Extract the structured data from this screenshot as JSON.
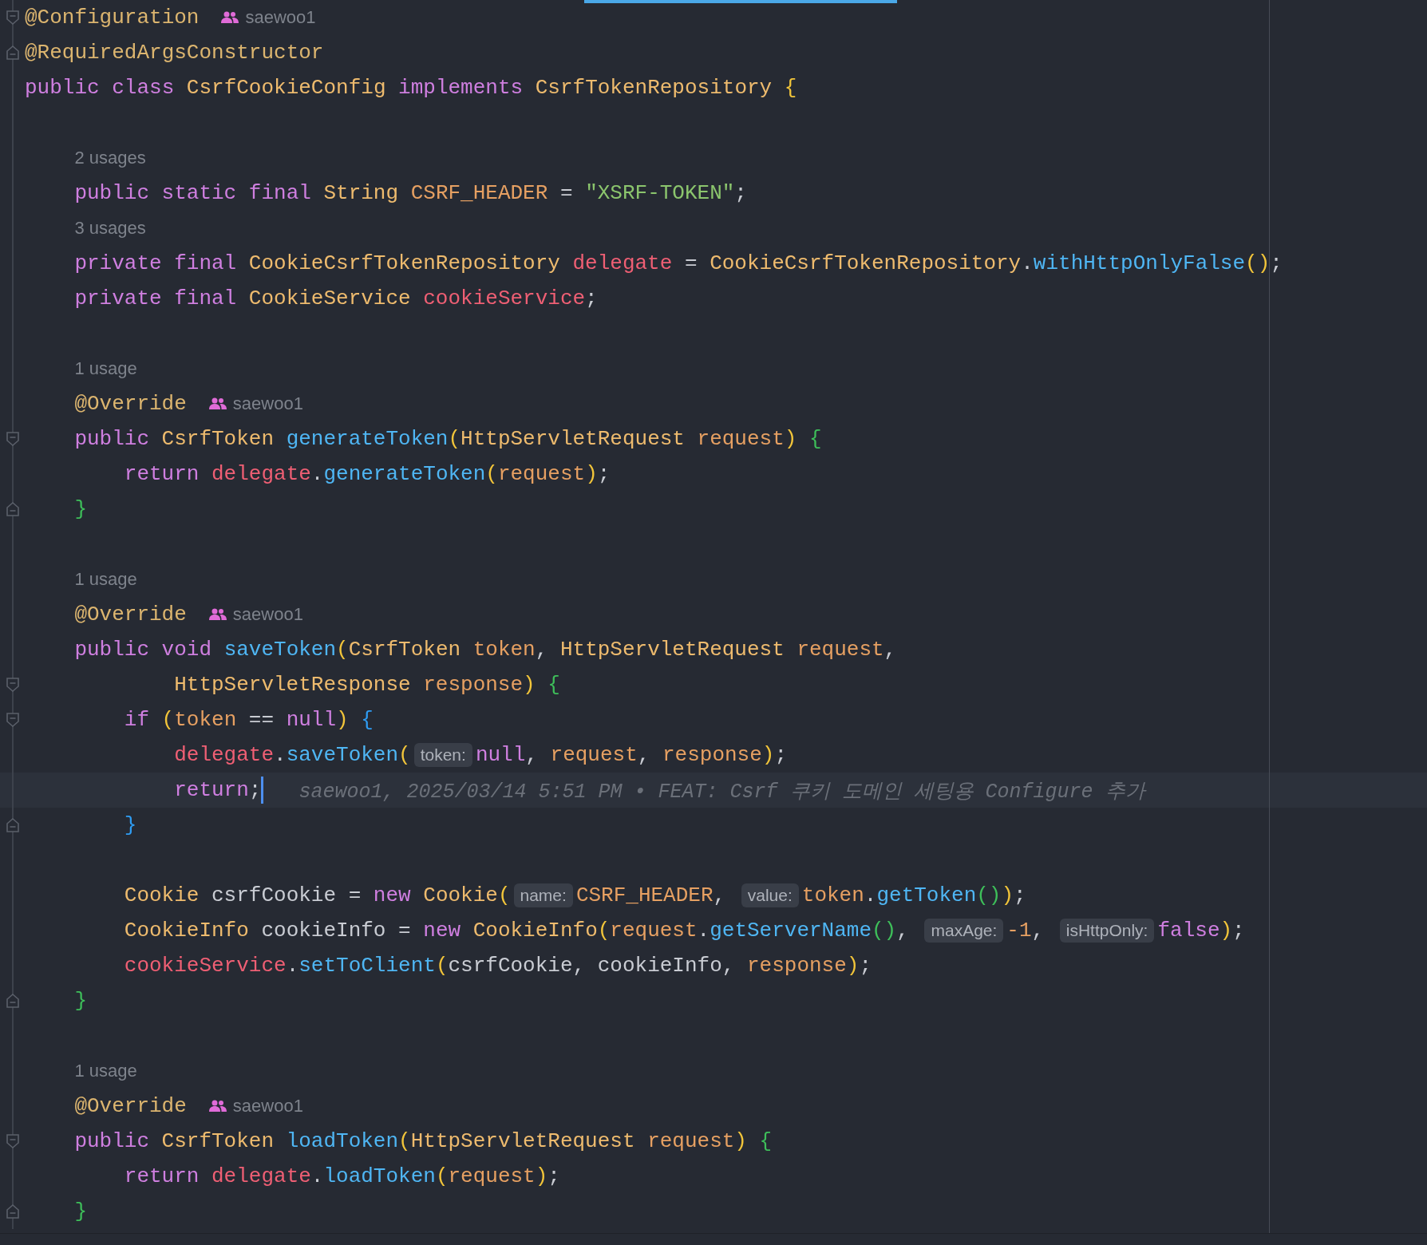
{
  "editor": {
    "lines": [
      {
        "kind": "code",
        "fold_start": true,
        "fold_end": false,
        "current": false,
        "tokens": [
          {
            "kind": "ann",
            "text": "@Configuration"
          },
          {
            "kind": "author",
            "text": "saewoo1"
          }
        ]
      },
      {
        "kind": "code",
        "fold_start": false,
        "fold_end": true,
        "current": false,
        "tokens": [
          {
            "kind": "ann",
            "text": "@RequiredArgsConstructor"
          }
        ]
      },
      {
        "kind": "code",
        "fold_start": false,
        "fold_end": false,
        "current": false,
        "tokens": [
          {
            "kind": "kw",
            "text": "public class "
          },
          {
            "kind": "type",
            "text": "CsrfCookieConfig "
          },
          {
            "kind": "kw",
            "text": "implements "
          },
          {
            "kind": "type",
            "text": "CsrfTokenRepository "
          },
          {
            "kind": "py",
            "text": "{"
          }
        ],
        "children": [
          {
            "kind": "blank"
          },
          {
            "kind": "usages",
            "text": "2 usages"
          },
          {
            "kind": "code",
            "fold_start": false,
            "fold_end": false,
            "current": false,
            "tokens": [
              {
                "kind": "kw",
                "text": "public static final "
              },
              {
                "kind": "type",
                "text": "String "
              },
              {
                "kind": "const",
                "text": "CSRF_HEADER"
              },
              {
                "kind": "plain",
                "text": " = "
              },
              {
                "kind": "str",
                "text": "\"XSRF-TOKEN\""
              },
              {
                "kind": "plain",
                "text": ";"
              }
            ]
          },
          {
            "kind": "usages",
            "text": "3 usages"
          },
          {
            "kind": "code",
            "fold_start": false,
            "fold_end": false,
            "current": false,
            "tokens": [
              {
                "kind": "kw",
                "text": "private final "
              },
              {
                "kind": "type",
                "text": "CookieCsrfTokenRepository "
              },
              {
                "kind": "field",
                "text": "delegate"
              },
              {
                "kind": "plain",
                "text": " = "
              },
              {
                "kind": "type",
                "text": "CookieCsrfTokenRepository"
              },
              {
                "kind": "plain",
                "text": "."
              },
              {
                "kind": "fn",
                "text": "withHttpOnlyFalse"
              },
              {
                "kind": "py",
                "text": "()"
              },
              {
                "kind": "plain",
                "text": ";"
              }
            ]
          },
          {
            "kind": "code",
            "fold_start": false,
            "fold_end": false,
            "current": false,
            "tokens": [
              {
                "kind": "kw",
                "text": "private final "
              },
              {
                "kind": "type",
                "text": "CookieService "
              },
              {
                "kind": "field",
                "text": "cookieService"
              },
              {
                "kind": "plain",
                "text": ";"
              }
            ]
          },
          {
            "kind": "blank"
          },
          {
            "kind": "usages",
            "text": "1 usage"
          },
          {
            "kind": "code",
            "fold_start": false,
            "fold_end": false,
            "current": false,
            "tokens": [
              {
                "kind": "ann",
                "text": "@Override"
              },
              {
                "kind": "author",
                "text": "saewoo1"
              }
            ]
          },
          {
            "kind": "code",
            "fold_start": true,
            "fold_end": false,
            "current": false,
            "tokens": [
              {
                "kind": "kw",
                "text": "public "
              },
              {
                "kind": "type",
                "text": "CsrfToken "
              },
              {
                "kind": "fn",
                "text": "generateToken"
              },
              {
                "kind": "py",
                "text": "("
              },
              {
                "kind": "type",
                "text": "HttpServletRequest "
              },
              {
                "kind": "param",
                "text": "request"
              },
              {
                "kind": "py",
                "text": ")"
              },
              {
                "kind": "pg",
                "text": " {"
              }
            ],
            "children": [
              {
                "kind": "code",
                "fold_start": false,
                "fold_end": false,
                "current": false,
                "tokens": [
                  {
                    "kind": "kw",
                    "text": "return "
                  },
                  {
                    "kind": "field",
                    "text": "delegate"
                  },
                  {
                    "kind": "plain",
                    "text": "."
                  },
                  {
                    "kind": "fn",
                    "text": "generateToken"
                  },
                  {
                    "kind": "py",
                    "text": "("
                  },
                  {
                    "kind": "param",
                    "text": "request"
                  },
                  {
                    "kind": "py",
                    "text": ")"
                  },
                  {
                    "kind": "plain",
                    "text": ";"
                  }
                ]
              }
            ]
          },
          {
            "kind": "code",
            "fold_start": false,
            "fold_end": true,
            "current": false,
            "tokens": [
              {
                "kind": "pg",
                "text": "}"
              }
            ]
          },
          {
            "kind": "blank"
          },
          {
            "kind": "usages",
            "text": "1 usage"
          },
          {
            "kind": "code",
            "fold_start": false,
            "fold_end": false,
            "current": false,
            "tokens": [
              {
                "kind": "ann",
                "text": "@Override"
              },
              {
                "kind": "author",
                "text": "saewoo1"
              }
            ]
          },
          {
            "kind": "code",
            "fold_start": false,
            "fold_end": false,
            "current": false,
            "tokens": [
              {
                "kind": "kw",
                "text": "public void "
              },
              {
                "kind": "fn",
                "text": "saveToken"
              },
              {
                "kind": "py",
                "text": "("
              },
              {
                "kind": "type",
                "text": "CsrfToken "
              },
              {
                "kind": "param",
                "text": "token"
              },
              {
                "kind": "plain",
                "text": ", "
              },
              {
                "kind": "type",
                "text": "HttpServletRequest "
              },
              {
                "kind": "param",
                "text": "request"
              },
              {
                "kind": "plain",
                "text": ","
              }
            ]
          },
          {
            "kind": "continuation",
            "fold_start": true,
            "fold_end": false,
            "current": false,
            "tokens": [
              {
                "kind": "type",
                "text": "HttpServletResponse "
              },
              {
                "kind": "param",
                "text": "response"
              },
              {
                "kind": "py",
                "text": ")"
              },
              {
                "kind": "pg",
                "text": " {"
              }
            ],
            "children": [
              {
                "kind": "code",
                "fold_start": true,
                "fold_end": false,
                "current": false,
                "tokens": [
                  {
                    "kind": "kw",
                    "text": "if "
                  },
                  {
                    "kind": "py",
                    "text": "("
                  },
                  {
                    "kind": "param",
                    "text": "token"
                  },
                  {
                    "kind": "plain",
                    "text": " == "
                  },
                  {
                    "kind": "kw",
                    "text": "null"
                  },
                  {
                    "kind": "py",
                    "text": ")"
                  },
                  {
                    "kind": "pb",
                    "text": " {"
                  }
                ],
                "children": [
                  {
                    "kind": "code",
                    "fold_start": false,
                    "fold_end": false,
                    "current": false,
                    "tokens": [
                      {
                        "kind": "field",
                        "text": "delegate"
                      },
                      {
                        "kind": "plain",
                        "text": "."
                      },
                      {
                        "kind": "fn",
                        "text": "saveToken"
                      },
                      {
                        "kind": "py",
                        "text": "("
                      },
                      {
                        "kind": "hint",
                        "text": "token:"
                      },
                      {
                        "kind": "kw",
                        "text": "null"
                      },
                      {
                        "kind": "plain",
                        "text": ", "
                      },
                      {
                        "kind": "param",
                        "text": "request"
                      },
                      {
                        "kind": "plain",
                        "text": ", "
                      },
                      {
                        "kind": "param",
                        "text": "response"
                      },
                      {
                        "kind": "py",
                        "text": ")"
                      },
                      {
                        "kind": "plain",
                        "text": ";"
                      }
                    ]
                  },
                  {
                    "kind": "code",
                    "fold_start": false,
                    "fold_end": false,
                    "current": true,
                    "tokens": [
                      {
                        "kind": "kw",
                        "text": "return"
                      },
                      {
                        "kind": "plain",
                        "text": ";"
                      },
                      {
                        "kind": "blame",
                        "text": "saewoo1, 2025/03/14 5:51 PM • FEAT: Csrf 쿠키 도메인 세팅용 Configure 추가"
                      }
                    ]
                  }
                ]
              },
              {
                "kind": "code",
                "fold_start": false,
                "fold_end": true,
                "current": false,
                "tokens": [
                  {
                    "kind": "pb",
                    "text": "}"
                  }
                ]
              },
              {
                "kind": "blank"
              },
              {
                "kind": "code",
                "fold_start": false,
                "fold_end": false,
                "current": false,
                "tokens": [
                  {
                    "kind": "type",
                    "text": "Cookie "
                  },
                  {
                    "kind": "plain",
                    "text": "csrfCookie = "
                  },
                  {
                    "kind": "kw",
                    "text": "new "
                  },
                  {
                    "kind": "type",
                    "text": "Cookie"
                  },
                  {
                    "kind": "py",
                    "text": "("
                  },
                  {
                    "kind": "hint",
                    "text": "name:"
                  },
                  {
                    "kind": "const",
                    "text": "CSRF_HEADER"
                  },
                  {
                    "kind": "plain",
                    "text": ", "
                  },
                  {
                    "kind": "hint",
                    "text": "value:"
                  },
                  {
                    "kind": "param",
                    "text": "token"
                  },
                  {
                    "kind": "plain",
                    "text": "."
                  },
                  {
                    "kind": "fn",
                    "text": "getToken"
                  },
                  {
                    "kind": "pg",
                    "text": "()"
                  },
                  {
                    "kind": "py",
                    "text": ")"
                  },
                  {
                    "kind": "plain",
                    "text": ";"
                  }
                ]
              },
              {
                "kind": "code",
                "fold_start": false,
                "fold_end": false,
                "current": false,
                "tokens": [
                  {
                    "kind": "type",
                    "text": "CookieInfo "
                  },
                  {
                    "kind": "plain",
                    "text": "cookieInfo = "
                  },
                  {
                    "kind": "kw",
                    "text": "new "
                  },
                  {
                    "kind": "type",
                    "text": "CookieInfo"
                  },
                  {
                    "kind": "py",
                    "text": "("
                  },
                  {
                    "kind": "param",
                    "text": "request"
                  },
                  {
                    "kind": "plain",
                    "text": "."
                  },
                  {
                    "kind": "fn",
                    "text": "getServerName"
                  },
                  {
                    "kind": "pg",
                    "text": "()"
                  },
                  {
                    "kind": "plain",
                    "text": ", "
                  },
                  {
                    "kind": "hint",
                    "text": "maxAge:"
                  },
                  {
                    "kind": "num",
                    "text": "-1"
                  },
                  {
                    "kind": "plain",
                    "text": ", "
                  },
                  {
                    "kind": "hint",
                    "text": "isHttpOnly:"
                  },
                  {
                    "kind": "kw",
                    "text": "false"
                  },
                  {
                    "kind": "py",
                    "text": ")"
                  },
                  {
                    "kind": "plain",
                    "text": ";"
                  }
                ]
              },
              {
                "kind": "code",
                "fold_start": false,
                "fold_end": false,
                "current": false,
                "tokens": [
                  {
                    "kind": "field",
                    "text": "cookieService"
                  },
                  {
                    "kind": "plain",
                    "text": "."
                  },
                  {
                    "kind": "fn",
                    "text": "setToClient"
                  },
                  {
                    "kind": "py",
                    "text": "("
                  },
                  {
                    "kind": "plain",
                    "text": "csrfCookie, cookieInfo, "
                  },
                  {
                    "kind": "param",
                    "text": "response"
                  },
                  {
                    "kind": "py",
                    "text": ")"
                  },
                  {
                    "kind": "plain",
                    "text": ";"
                  }
                ]
              }
            ]
          },
          {
            "kind": "code",
            "fold_start": false,
            "fold_end": true,
            "current": false,
            "tokens": [
              {
                "kind": "pg",
                "text": "}"
              }
            ]
          },
          {
            "kind": "blank"
          },
          {
            "kind": "usages",
            "text": "1 usage"
          },
          {
            "kind": "code",
            "fold_start": false,
            "fold_end": false,
            "current": false,
            "tokens": [
              {
                "kind": "ann",
                "text": "@Override"
              },
              {
                "kind": "author",
                "text": "saewoo1"
              }
            ]
          },
          {
            "kind": "code",
            "fold_start": true,
            "fold_end": false,
            "current": false,
            "tokens": [
              {
                "kind": "kw",
                "text": "public "
              },
              {
                "kind": "type",
                "text": "CsrfToken "
              },
              {
                "kind": "fn",
                "text": "loadToken"
              },
              {
                "kind": "py",
                "text": "("
              },
              {
                "kind": "type",
                "text": "HttpServletRequest "
              },
              {
                "kind": "param",
                "text": "request"
              },
              {
                "kind": "py",
                "text": ")"
              },
              {
                "kind": "pg",
                "text": " {"
              }
            ],
            "children": [
              {
                "kind": "code",
                "fold_start": false,
                "fold_end": false,
                "current": false,
                "tokens": [
                  {
                    "kind": "kw",
                    "text": "return "
                  },
                  {
                    "kind": "field",
                    "text": "delegate"
                  },
                  {
                    "kind": "plain",
                    "text": "."
                  },
                  {
                    "kind": "fn",
                    "text": "loadToken"
                  },
                  {
                    "kind": "py",
                    "text": "("
                  },
                  {
                    "kind": "param",
                    "text": "request"
                  },
                  {
                    "kind": "py",
                    "text": ")"
                  },
                  {
                    "kind": "plain",
                    "text": ";"
                  }
                ]
              }
            ]
          },
          {
            "kind": "code",
            "fold_start": false,
            "fold_end": true,
            "current": false,
            "tokens": [
              {
                "kind": "pg",
                "text": "}"
              }
            ]
          }
        ]
      }
    ]
  }
}
